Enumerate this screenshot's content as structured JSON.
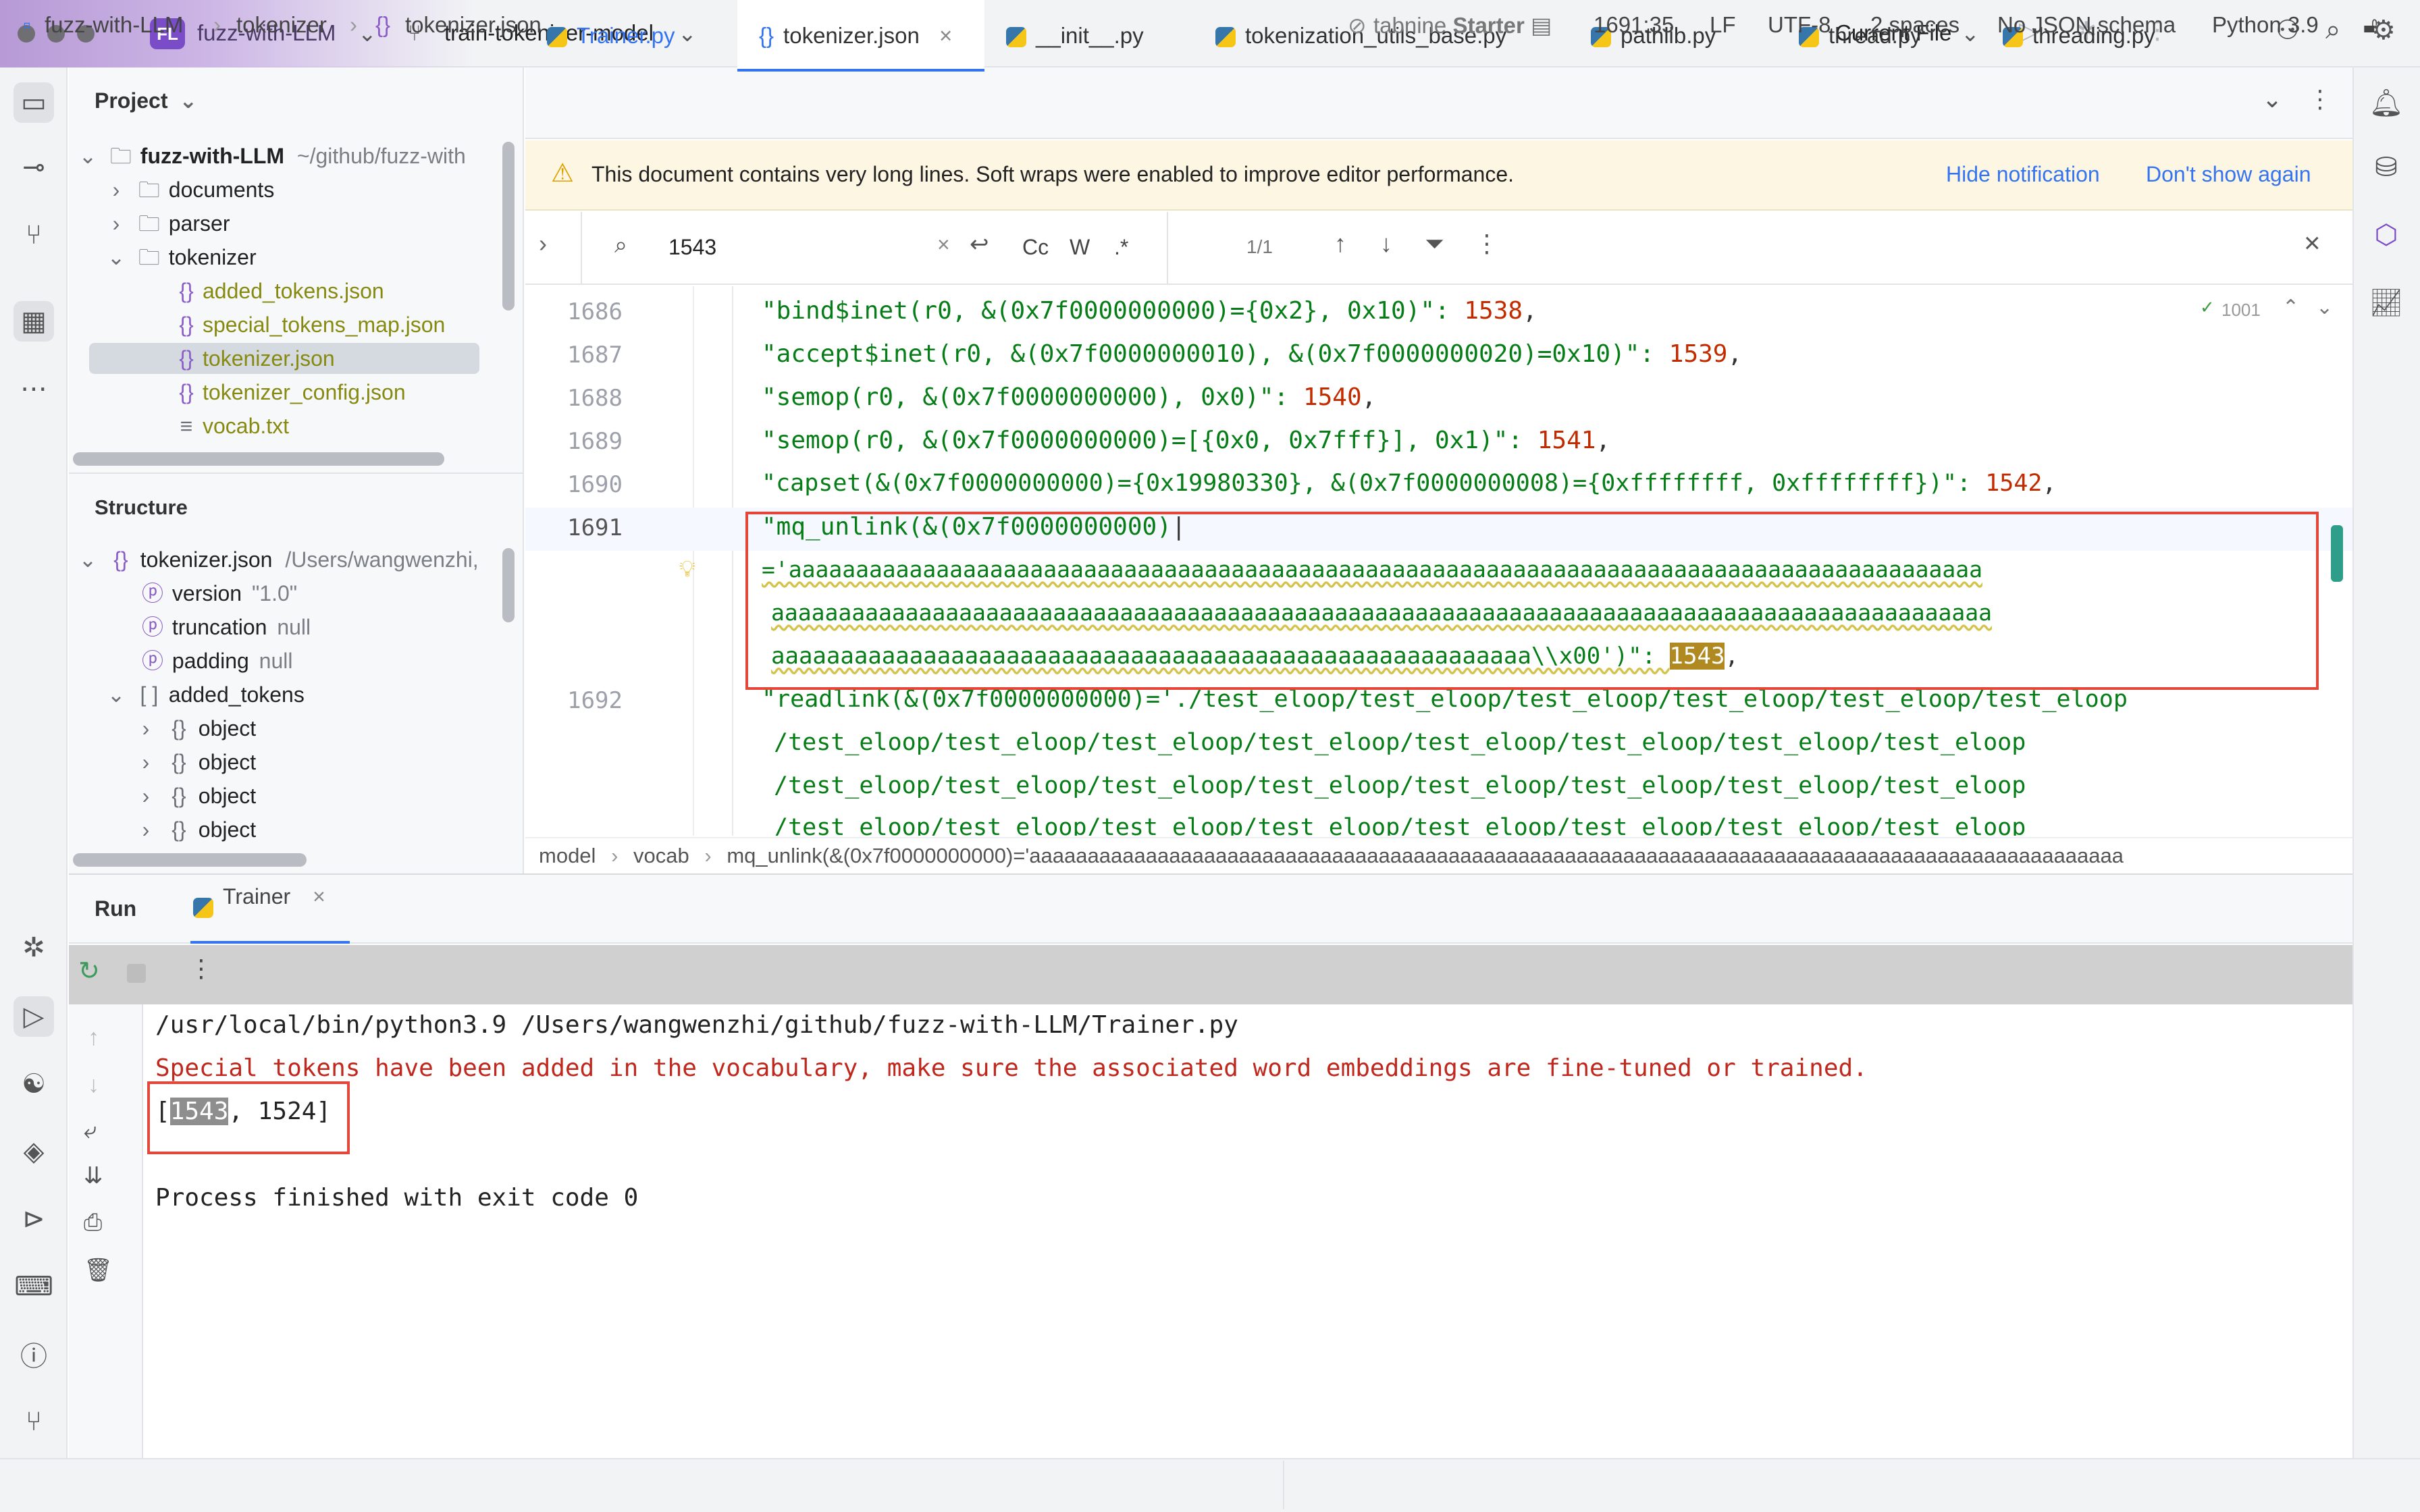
{
  "titlebar": {
    "project_badge": "FL",
    "project_name": "fuzz-with-LLM",
    "branch": "train-tokenizer-model",
    "run_config": "Current File"
  },
  "project_panel": {
    "title": "Project",
    "root_name": "fuzz-with-LLM",
    "root_path": "~/github/fuzz-with",
    "folders": [
      "documents",
      "parser",
      "tokenizer"
    ],
    "files": [
      "added_tokens.json",
      "special_tokens_map.json",
      "tokenizer.json",
      "tokenizer_config.json",
      "vocab.txt"
    ]
  },
  "structure_panel": {
    "title": "Structure",
    "root_name": "tokenizer.json",
    "root_path": "/Users/wangwenzhi,",
    "props": [
      {
        "key": "version",
        "value": "\"1.0\""
      },
      {
        "key": "truncation",
        "value": "null"
      },
      {
        "key": "padding",
        "value": "null"
      }
    ],
    "array_name": "added_tokens",
    "objects": [
      "object",
      "object",
      "object",
      "object"
    ]
  },
  "tabs": [
    {
      "label": "Trainer.py"
    },
    {
      "label": "tokenizer.json"
    },
    {
      "label": "__init__.py"
    },
    {
      "label": "tokenization_utils_base.py"
    },
    {
      "label": "pathlib.py"
    },
    {
      "label": "thread.py"
    },
    {
      "label": "threading.py"
    }
  ],
  "notification": {
    "message": "This document contains very long lines. Soft wraps were enabled to improve editor performance.",
    "hide": "Hide notification",
    "dont_show": "Don't show again"
  },
  "search": {
    "query": "1543",
    "match_case": "Cc",
    "words": "W",
    "regex": ".*",
    "count": "1/1"
  },
  "editor": {
    "inspection_count": "1001",
    "lines": [
      {
        "num": "1686",
        "text": "\"bind$inet(r0, &(0x7f0000000000)={0x2}, 0x10)\": ",
        "value": "1538",
        "end": ","
      },
      {
        "num": "1687",
        "text": "\"accept$inet(r0, &(0x7f0000000010), &(0x7f0000000020)=0x10)\": ",
        "value": "1539",
        "end": ","
      },
      {
        "num": "1688",
        "text": "\"semop(r0, &(0x7f0000000000), 0x0)\": ",
        "value": "1540",
        "end": ","
      },
      {
        "num": "1689",
        "text": "\"semop(r0, &(0x7f0000000000)=[{0x0, 0x7fff}], 0x1)\": ",
        "value": "1541",
        "end": ","
      },
      {
        "num": "1690",
        "text": "\"capset(&(0x7f0000000000)={0x19980330}, &(0x7f0000000008)={0xffffffff, 0xffffffff})\": ",
        "value": "1542",
        "end": ","
      },
      {
        "num": "1691",
        "text": "\"mq_unlink(&(0x7f0000000000)",
        "value": "",
        "end": ""
      },
      {
        "num": "",
        "text": "='aaaaaaaaaaaaaaaaaaaaaaaaaaaaaaaaaaaaaaaaaaaaaaaaaaaaaaaaaaaaaaaaaaaaaaaaaaaaaaaaaaaaaaaaa",
        "value": "",
        "end": ""
      },
      {
        "num": "",
        "text": "aaaaaaaaaaaaaaaaaaaaaaaaaaaaaaaaaaaaaaaaaaaaaaaaaaaaaaaaaaaaaaaaaaaaaaaaaaaaaaaaaaaaaaaaaaa",
        "value": "",
        "end": ""
      },
      {
        "num": "",
        "text": "aaaaaaaaaaaaaaaaaaaaaaaaaaaaaaaaaaaaaaaaaaaaaaaaaaaaaaa\\\\x00')\": ",
        "value": "1543",
        "end": ","
      },
      {
        "num": "1692",
        "text": "\"readlink(&(0x7f0000000000)='./test_eloop/test_eloop/test_eloop/test_eloop/test_eloop/test_eloop",
        "value": "",
        "end": ""
      },
      {
        "num": "",
        "text": "/test_eloop/test_eloop/test_eloop/test_eloop/test_eloop/test_eloop/test_eloop/test_eloop",
        "value": "",
        "end": ""
      },
      {
        "num": "",
        "text": "/test_eloop/test_eloop/test_eloop/test_eloop/test_eloop/test_eloop/test_eloop/test_eloop",
        "value": "",
        "end": ""
      },
      {
        "num": "",
        "text": "/test_eloop/test_eloop/test_eloop/test_eloop/test_eloop/test_eloop/test_eloop/test_eloop",
        "value": "",
        "end": ""
      }
    ],
    "breadcrumb": [
      "model",
      "vocab",
      "mq_unlink(&(0x7f0000000000)='aaaaaaaaaaaaaaaaaaaaaaaaaaaaaaaaaaaaaaaaaaaaaaaaaaaaaaaaaaaaaaaaaaaaaaaaaaaaaaaaaaaaaaaaaaaaaa"
    ]
  },
  "run": {
    "title": "Run",
    "tab": "Trainer",
    "console": {
      "command": "/usr/local/bin/python3.9 /Users/wangwenzhi/github/fuzz-with-LLM/Trainer.py",
      "warning": "Special tokens have been added in the vocabulary, make sure the associated word embeddings are fine-tuned or trained.",
      "output_open": "[",
      "output_hl": "1543",
      "output_rest": ", 1524]",
      "finish": "Process finished with exit code 0"
    }
  },
  "statusbar": {
    "path": [
      "fuzz-with-LLM",
      "tokenizer",
      "tokenizer.json"
    ],
    "tabnine": "tabnine",
    "tabnine_plan": "Starter",
    "position": "1691:35",
    "line_sep": "LF",
    "encoding": "UTF-8",
    "indent": "2 spaces",
    "schema": "No JSON schema",
    "interpreter": "Python 3.9"
  },
  "colors": {
    "accent": "#3574f0",
    "highlight_box": "#e5463a",
    "search_match": "#b08a20",
    "string": "#067d17",
    "number": "#c22b00"
  }
}
